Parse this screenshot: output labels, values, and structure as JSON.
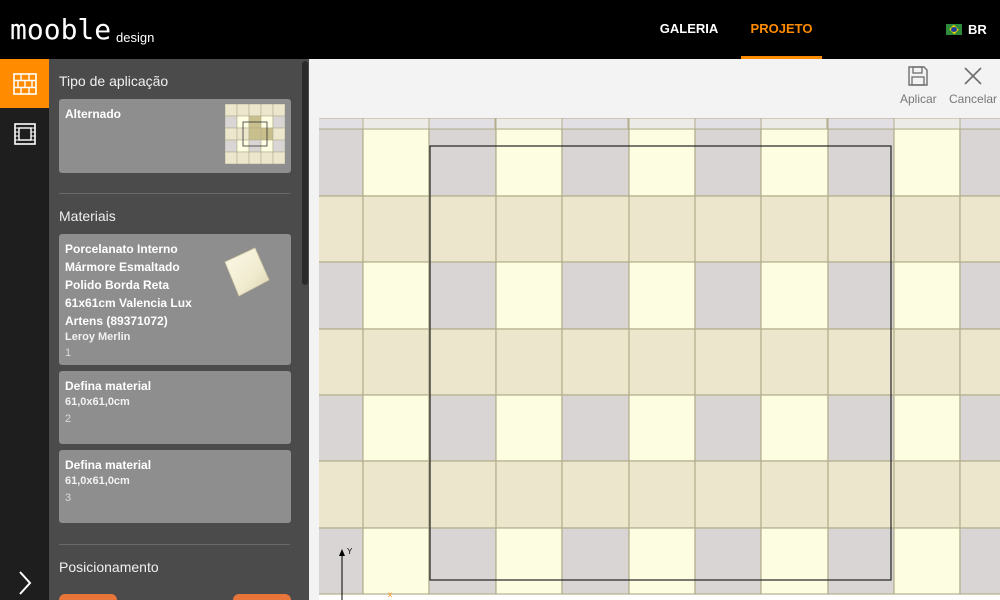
{
  "header": {
    "logo_text": "mooble",
    "logo_sub": "design",
    "nav": [
      {
        "label": "GALERIA",
        "active": false
      },
      {
        "label": "PROJETO",
        "active": true
      }
    ],
    "language": "BR"
  },
  "rail": {
    "items": [
      {
        "icon": "brick-wall-icon",
        "active": true
      },
      {
        "icon": "film-frame-icon",
        "active": false
      }
    ],
    "expand_icon": "chevron-right-icon"
  },
  "panel": {
    "application": {
      "title": "Tipo de aplicação",
      "selected": "Alternado"
    },
    "materials": {
      "title": "Materiais",
      "items": [
        {
          "name": "Porcelanato Interno Mármore Esmaltado Polido Borda Reta 61x61cm Valencia Lux Artens (89371072)",
          "lines": [
            "Porcelanato Interno",
            "Mármore Esmaltado",
            "Polido Borda Reta",
            "61x61cm Valencia Lux",
            "Artens (89371072)"
          ],
          "store": "Leroy Merlin",
          "index": "1"
        },
        {
          "name": "Defina material",
          "size": "61,0x61,0cm",
          "index": "2"
        },
        {
          "name": "Defina material",
          "size": "61,0x61,0cm",
          "index": "3"
        }
      ]
    },
    "positioning": {
      "title": "Posicionamento"
    }
  },
  "toolbar": {
    "apply_label": "Aplicar",
    "cancel_label": "Cancelar"
  },
  "canvas": {
    "axis_y_label": "Y",
    "axis_x_label": "x",
    "colors": {
      "beige": "#ece6cd",
      "cream": "#fdfde2",
      "grey": "#d9d5d5",
      "grout": "#b2ae8c",
      "accent": "#ff8c00"
    }
  }
}
